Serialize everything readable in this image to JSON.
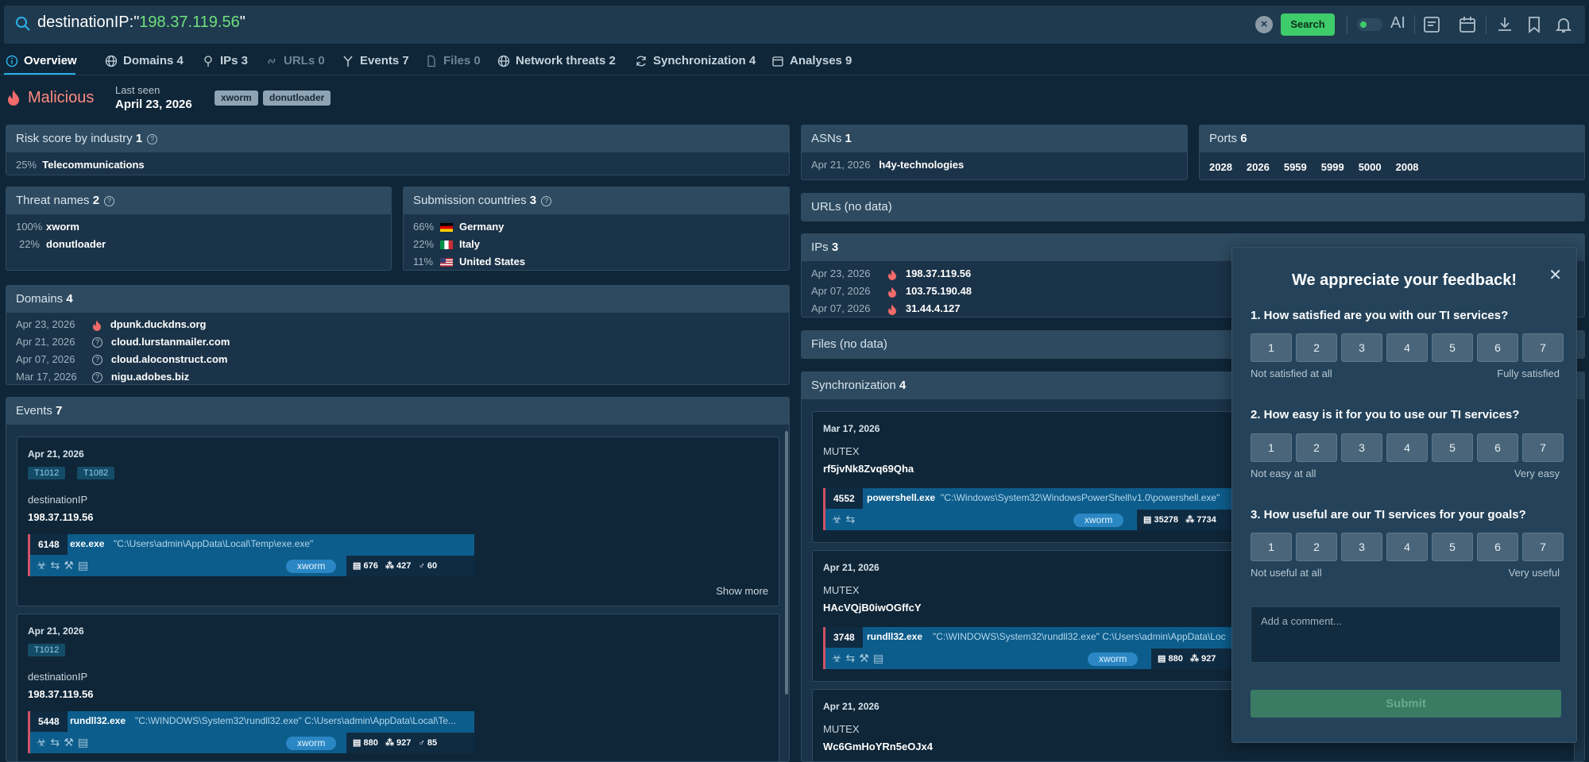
{
  "search": {
    "query_key": "destinationIP:\"",
    "query_value": "198.37.119.56",
    "query_end": "\"",
    "search_label": "Search",
    "ai_label": "AI"
  },
  "tabs": [
    {
      "label": "Overview",
      "icon": "info-icon"
    },
    {
      "label": "Domains 4",
      "icon": "globe-icon"
    },
    {
      "label": "IPs 3",
      "icon": "pin-icon"
    },
    {
      "label": "URLs 0",
      "icon": "link-icon"
    },
    {
      "label": "Events 7",
      "icon": "branch-icon"
    },
    {
      "label": "Files 0",
      "icon": "file-icon"
    },
    {
      "label": "Network threats 2",
      "icon": "globe-icon"
    },
    {
      "label": "Synchronization 4",
      "icon": "sync-icon"
    },
    {
      "label": "Analyses 9",
      "icon": "calendar-icon"
    }
  ],
  "summary": {
    "verdict": "Malicious",
    "last_seen_label": "Last seen",
    "last_seen": "April 23, 2026",
    "tags": [
      "xworm",
      "donutloader"
    ]
  },
  "risk": {
    "title": "Risk score by industry",
    "count": "1",
    "rows": [
      {
        "pct": "25%",
        "name": "Telecommunications"
      }
    ]
  },
  "threat_names": {
    "title": "Threat names",
    "count": "2",
    "rows": [
      {
        "pct": "100%",
        "name": "xworm"
      },
      {
        "pct": "22%",
        "name": "donutloader"
      }
    ]
  },
  "countries": {
    "title": "Submission countries",
    "count": "3",
    "rows": [
      {
        "pct": "66%",
        "name": "Germany"
      },
      {
        "pct": "22%",
        "name": "Italy"
      },
      {
        "pct": "11%",
        "name": "United States"
      }
    ]
  },
  "domains": {
    "title": "Domains",
    "count": "4",
    "rows": [
      {
        "date": "Apr 23, 2026",
        "name": "dpunk.duckdns.org",
        "icon": "flame-icon"
      },
      {
        "date": "Apr 21, 2026",
        "name": "cloud.lurstanmailer.com",
        "icon": "question-icon"
      },
      {
        "date": "Apr 07, 2026",
        "name": "cloud.aloconstruct.com",
        "icon": "question-icon"
      },
      {
        "date": "Mar 17, 2026",
        "name": "nigu.adobes.biz",
        "icon": "question-icon"
      }
    ]
  },
  "events": {
    "title": "Events",
    "count": "7",
    "show_more": "Show more",
    "items": [
      {
        "date": "Apr 21, 2026",
        "mitre": [
          "T1012",
          "T1082"
        ],
        "label": "destinationIP",
        "value": "198.37.119.56",
        "pid": "6148",
        "proc": "exe.exe",
        "cmd": "\"C:\\Users\\admin\\AppData\\Local\\Temp\\exe.exe\"",
        "pill": "xworm",
        "s1": "676",
        "s2": "427",
        "s3": "60"
      },
      {
        "date": "Apr 21, 2026",
        "mitre": [
          "T1012"
        ],
        "label": "destinationIP",
        "value": "198.37.119.56",
        "pid": "5448",
        "proc": "rundll32.exe",
        "cmd": "\"C:\\WINDOWS\\System32\\rundll32.exe\" C:\\Users\\admin\\AppData\\Local\\Te...",
        "pill": "xworm",
        "s1": "880",
        "s2": "927",
        "s3": "85"
      }
    ]
  },
  "asns": {
    "title": "ASNs",
    "count": "1",
    "rows": [
      {
        "date": "Apr 21, 2026",
        "name": "h4y-technologies"
      }
    ]
  },
  "ports": {
    "title": "Ports",
    "count": "6",
    "values": [
      "2028",
      "2026",
      "5959",
      "5999",
      "5000",
      "2008"
    ]
  },
  "urls": {
    "title": "URLs (no data)"
  },
  "ips": {
    "title": "IPs",
    "count": "3",
    "rows": [
      {
        "date": "Apr 23, 2026",
        "ip": "198.37.119.56"
      },
      {
        "date": "Apr 07, 2026",
        "ip": "103.75.190.48"
      },
      {
        "date": "Apr 07, 2026",
        "ip": "31.44.4.127"
      }
    ]
  },
  "files": {
    "title": "Files (no data)"
  },
  "sync": {
    "title": "Synchronization",
    "count": "4",
    "items": [
      {
        "date": "Mar 17, 2026",
        "type": "MUTEX",
        "value": "rf5jvNk8Zvq69Qha",
        "pid": "4552",
        "proc": "powershell.exe",
        "cmd": "\"C:\\Windows\\System32\\WindowsPowerShell\\v1.0\\powershell.exe\"",
        "pill": "xworm",
        "s1": "35278",
        "s2": "7734"
      },
      {
        "date": "Apr 21, 2026",
        "type": "MUTEX",
        "value": "HAcVQjB0iwOGffcY",
        "pid": "3748",
        "proc": "rundll32.exe",
        "cmd": "\"C:\\WINDOWS\\System32\\rundll32.exe\" C:\\Users\\admin\\AppData\\Loc",
        "pill": "xworm",
        "s1": "880",
        "s2": "927"
      },
      {
        "date": "Apr 21, 2026",
        "type": "MUTEX",
        "value": "Wc6GmHoYRn5eOJx4"
      }
    ]
  },
  "feedback": {
    "title": "We appreciate your feedback!",
    "questions": [
      {
        "q": "1. How satisfied are you with our TI services?",
        "low": "Not satisfied at all",
        "high": "Fully satisfied"
      },
      {
        "q": "2. How easy is it for you to use our TI services?",
        "low": "Not easy at all",
        "high": "Very easy"
      },
      {
        "q": "3. How useful are our TI services for your goals?",
        "low": "Not useful at all",
        "high": "Very useful"
      }
    ],
    "scale": [
      "1",
      "2",
      "3",
      "4",
      "5",
      "6",
      "7"
    ],
    "comment_placeholder": "Add a comment...",
    "submit": "Submit"
  },
  "colors": {
    "malicious": "#ff8a80",
    "accent": "#2ab0e6",
    "search_green": "#3ecb6a"
  }
}
